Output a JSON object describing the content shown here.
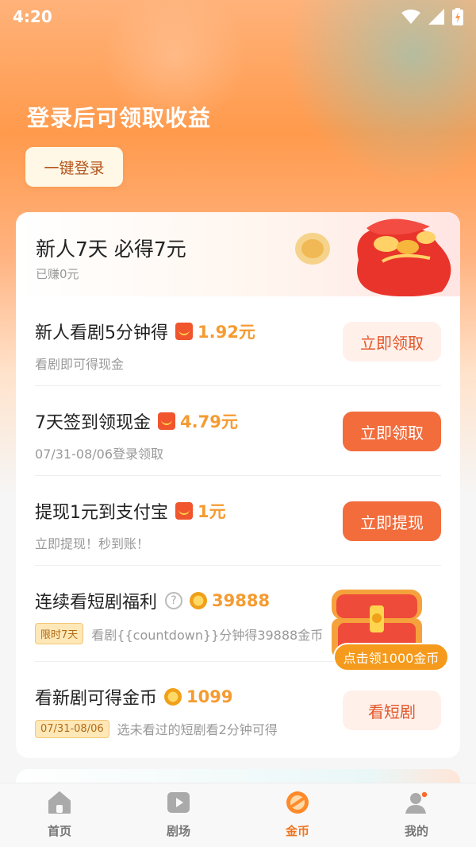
{
  "status_bar": {
    "time": "4:20"
  },
  "hero": {
    "title": "登录后可领取收益",
    "login_button": "一键登录"
  },
  "newcomer": {
    "title": "新人7天 必得7元",
    "earned": "已赚0元"
  },
  "tasks": [
    {
      "title": "新人看剧5分钟得",
      "reward_icon": "red-packet-icon",
      "reward": "1.92元",
      "desc": "看剧即可得现金",
      "button": "立即领取",
      "button_style": "light"
    },
    {
      "title": "7天签到领现金",
      "reward_icon": "red-packet-icon",
      "reward": "4.79元",
      "desc": "07/31-08/06登录领取",
      "button": "立即领取",
      "button_style": "solid"
    },
    {
      "title": "提现1元到支付宝",
      "reward_icon": "red-packet-icon",
      "reward": "1元",
      "desc": "立即提现！秒到账！",
      "button": "立即提现",
      "button_style": "solid"
    },
    {
      "title": "连续看短剧福利",
      "reward_icon": "coin-icon",
      "reward": "39888",
      "tag": "限时7天",
      "desc": "看剧{{countdown}}分钟得39888金币",
      "chest_badge": "点击领1000金币"
    },
    {
      "title": "看新剧可得金币",
      "reward_icon": "coin-icon",
      "reward": "1099",
      "tag": "07/31-08/06",
      "desc": "选未看过的短剧看2分钟可得",
      "button": "看短剧",
      "button_style": "light"
    }
  ],
  "tabbar": {
    "items": [
      {
        "label": "首页",
        "icon": "home-icon",
        "active": false
      },
      {
        "label": "剧场",
        "icon": "play-icon",
        "active": false
      },
      {
        "label": "金币",
        "icon": "coin-tab-icon",
        "active": true
      },
      {
        "label": "我的",
        "icon": "profile-icon",
        "active": false
      }
    ]
  },
  "colors": {
    "accent": "#f26c3c",
    "reward": "#f59b31",
    "active_tab": "#f0751f"
  }
}
